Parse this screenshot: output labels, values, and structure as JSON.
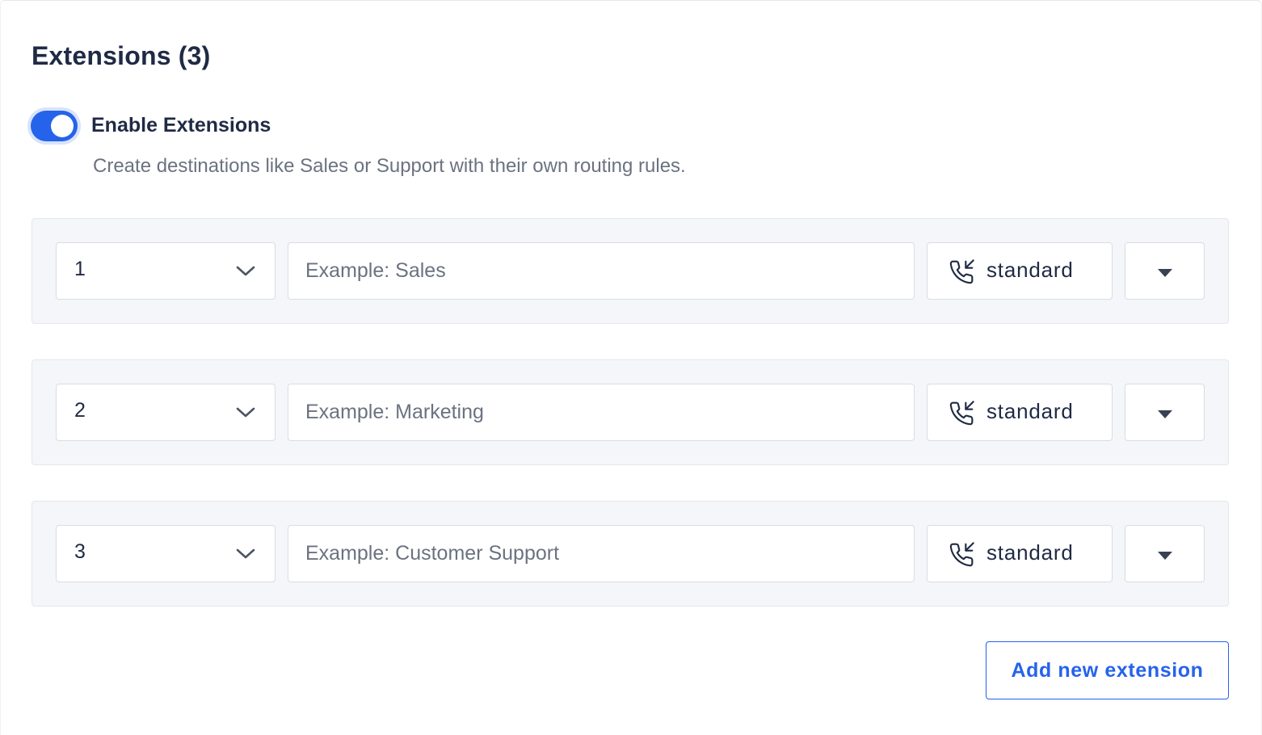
{
  "section": {
    "title": "Extensions (3)",
    "toggle": {
      "label": "Enable Extensions",
      "enabled": true,
      "accent_color": "#2563eb"
    },
    "helper_text": "Create destinations like Sales or Support with their own routing rules."
  },
  "extensions": [
    {
      "number": "1",
      "name_placeholder": "Example: Sales",
      "name_value": "",
      "routing_type": "standard",
      "type_icon": "incoming-call-icon",
      "menu_icon": "caret-down-icon"
    },
    {
      "number": "2",
      "name_placeholder": "Example: Marketing",
      "name_value": "",
      "routing_type": "standard",
      "type_icon": "incoming-call-icon",
      "menu_icon": "caret-down-icon"
    },
    {
      "number": "3",
      "name_placeholder": "Example: Customer Support",
      "name_value": "",
      "routing_type": "standard",
      "type_icon": "incoming-call-icon",
      "menu_icon": "caret-down-icon"
    }
  ],
  "actions": {
    "add_label": "Add new extension"
  }
}
